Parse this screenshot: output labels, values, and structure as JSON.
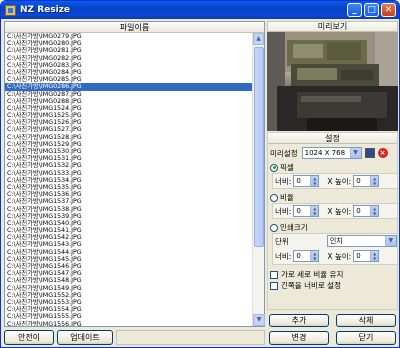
{
  "window": {
    "title": "NZ Resize"
  },
  "left_panel": {
    "header": "파일이름",
    "files": [
      "C:\\사진가방\\IMG0279.JPG",
      "C:\\사진가방\\IMG0280.JPG",
      "C:\\사진가방\\IMG0281.JPG",
      "C:\\사진가방\\IMG0282.JPG",
      "C:\\사진가방\\IMG0283.JPG",
      "C:\\사진가방\\IMG0284.JPG",
      "C:\\사진가방\\IMG0285.JPG",
      "C:\\사진가방\\IMG0286.JPG",
      "C:\\사진가방\\IMG0287.JPG",
      "C:\\사진가방\\IMG0288.JPG",
      "C:\\사진가방\\IMG1524.JPG",
      "C:\\사진가방\\IMG1525.JPG",
      "C:\\사진가방\\IMG1526.JPG",
      "C:\\사진가방\\IMG1527.JPG",
      "C:\\사진가방\\IMG1528.JPG",
      "C:\\사진가방\\IMG1529.JPG",
      "C:\\사진가방\\IMG1530.JPG",
      "C:\\사진가방\\IMG1531.JPG",
      "C:\\사진가방\\IMG1532.JPG",
      "C:\\사진가방\\IMG1533.JPG",
      "C:\\사진가방\\IMG1534.JPG",
      "C:\\사진가방\\IMG1535.JPG",
      "C:\\사진가방\\IMG1536.JPG",
      "C:\\사진가방\\IMG1537.JPG",
      "C:\\사진가방\\IMG1538.JPG",
      "C:\\사진가방\\IMG1539.JPG",
      "C:\\사진가방\\IMG1540.JPG",
      "C:\\사진가방\\IMG1541.JPG",
      "C:\\사진가방\\IMG1542.JPG",
      "C:\\사진가방\\IMG1543.JPG",
      "C:\\사진가방\\IMG1544.JPG",
      "C:\\사진가방\\IMG1545.JPG",
      "C:\\사진가방\\IMG1546.JPG",
      "C:\\사진가방\\IMG1547.JPG",
      "C:\\사진가방\\IMG1548.JPG",
      "C:\\사진가방\\IMG1549.JPG",
      "C:\\사진가방\\IMG1552.JPG",
      "C:\\사진가방\\IMG1553.JPG",
      "C:\\사진가방\\IMG1554.JPG",
      "C:\\사진가방\\IMG1555.JPG",
      "C:\\사진가방\\IMG1556.JPG",
      "C:\\사진가방\\IMG1557.JPG"
    ],
    "selected_index": 7,
    "buttons": {
      "clear": "안전이",
      "update": "업데이트"
    }
  },
  "preview": {
    "header": "미리보기"
  },
  "settings": {
    "title": "설정",
    "preset_label": "미리설정",
    "preset_value": "1024 X 768",
    "pixel_label": "픽셀",
    "ratio_label": "비율",
    "print_label": "인쇄크기",
    "width_label": "너비:",
    "height_label": "X 높이:",
    "width_value": "0",
    "height_value": "0",
    "unit_label": "단위",
    "unit_value": "인치",
    "keep_ratio_label": "가로 세로 비율 유지",
    "fit_width_label": "긴쪽을 너비로 설정",
    "add_button": "추가",
    "delete_button": "삭제",
    "convert_button": "변경",
    "close_button": "닫기"
  },
  "colors": {
    "title_bar": "#0a5ee8",
    "selection": "#316ac5",
    "face": "#ece9d8"
  }
}
